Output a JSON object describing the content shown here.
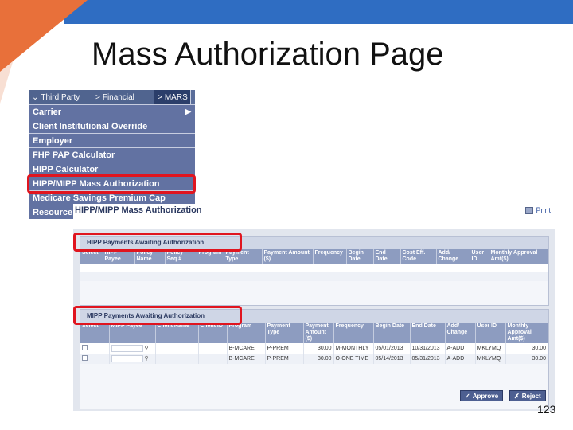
{
  "slide": {
    "title": "Mass Authorization Page",
    "page_number": "123"
  },
  "menu": {
    "tabs": [
      "Third Party",
      "Financial",
      "MARS"
    ],
    "items": [
      "Carrier",
      "Client Institutional Override",
      "Employer",
      "FHP PAP Calculator",
      "HIPP Calculator",
      "HIPP/MIPP Mass Authorization",
      "Medicare Savings Premium Cap",
      "Resource"
    ]
  },
  "app": {
    "title": "HIPP/MIPP Mass Authorization",
    "print_label": "Print",
    "panel1": {
      "heading": "HIPP Payments Awaiting Authorization",
      "columns": [
        "Select",
        "HIPP Payee",
        "Policy Name",
        "Policy Seq #",
        "Program",
        "Payment Type",
        "Payment Amount ($)",
        "Frequency",
        "Begin Date",
        "End Date",
        "Cost Eff. Code",
        "Add/ Change",
        "User ID",
        "Monthly Approval Amt($)"
      ]
    },
    "panel2": {
      "heading": "MIPP Payments Awaiting Authorization",
      "columns": [
        "Select",
        "MIPP Payee",
        "Client Name",
        "Client ID",
        "Program",
        "Payment Type",
        "Payment Amount ($)",
        "Frequency",
        "Begin Date",
        "End Date",
        "Add/ Change",
        "User ID",
        "Monthly Approval Amt($)"
      ],
      "rows": [
        {
          "program": "B-MCARE",
          "payment_type": "P-PREM",
          "amount": "30.00",
          "frequency": "M-MONTHLY",
          "begin": "05/01/2013",
          "end": "10/31/2013",
          "add_change": "A-ADD",
          "user_id": "MKLYMQ",
          "monthly": "30.00"
        },
        {
          "program": "B-MCARE",
          "payment_type": "P-PREM",
          "amount": "30.00",
          "frequency": "O-ONE TIME",
          "begin": "05/14/2013",
          "end": "05/31/2013",
          "add_change": "A-ADD",
          "user_id": "MKLYMQ",
          "monthly": "30.00"
        }
      ]
    },
    "approve_label": "Approve",
    "reject_label": "Reject"
  },
  "colors": {
    "menu_bg": "#6272a2",
    "highlight": "#e0151f",
    "header_blue": "#2f6dc2",
    "accent_orange": "#e8703a"
  }
}
